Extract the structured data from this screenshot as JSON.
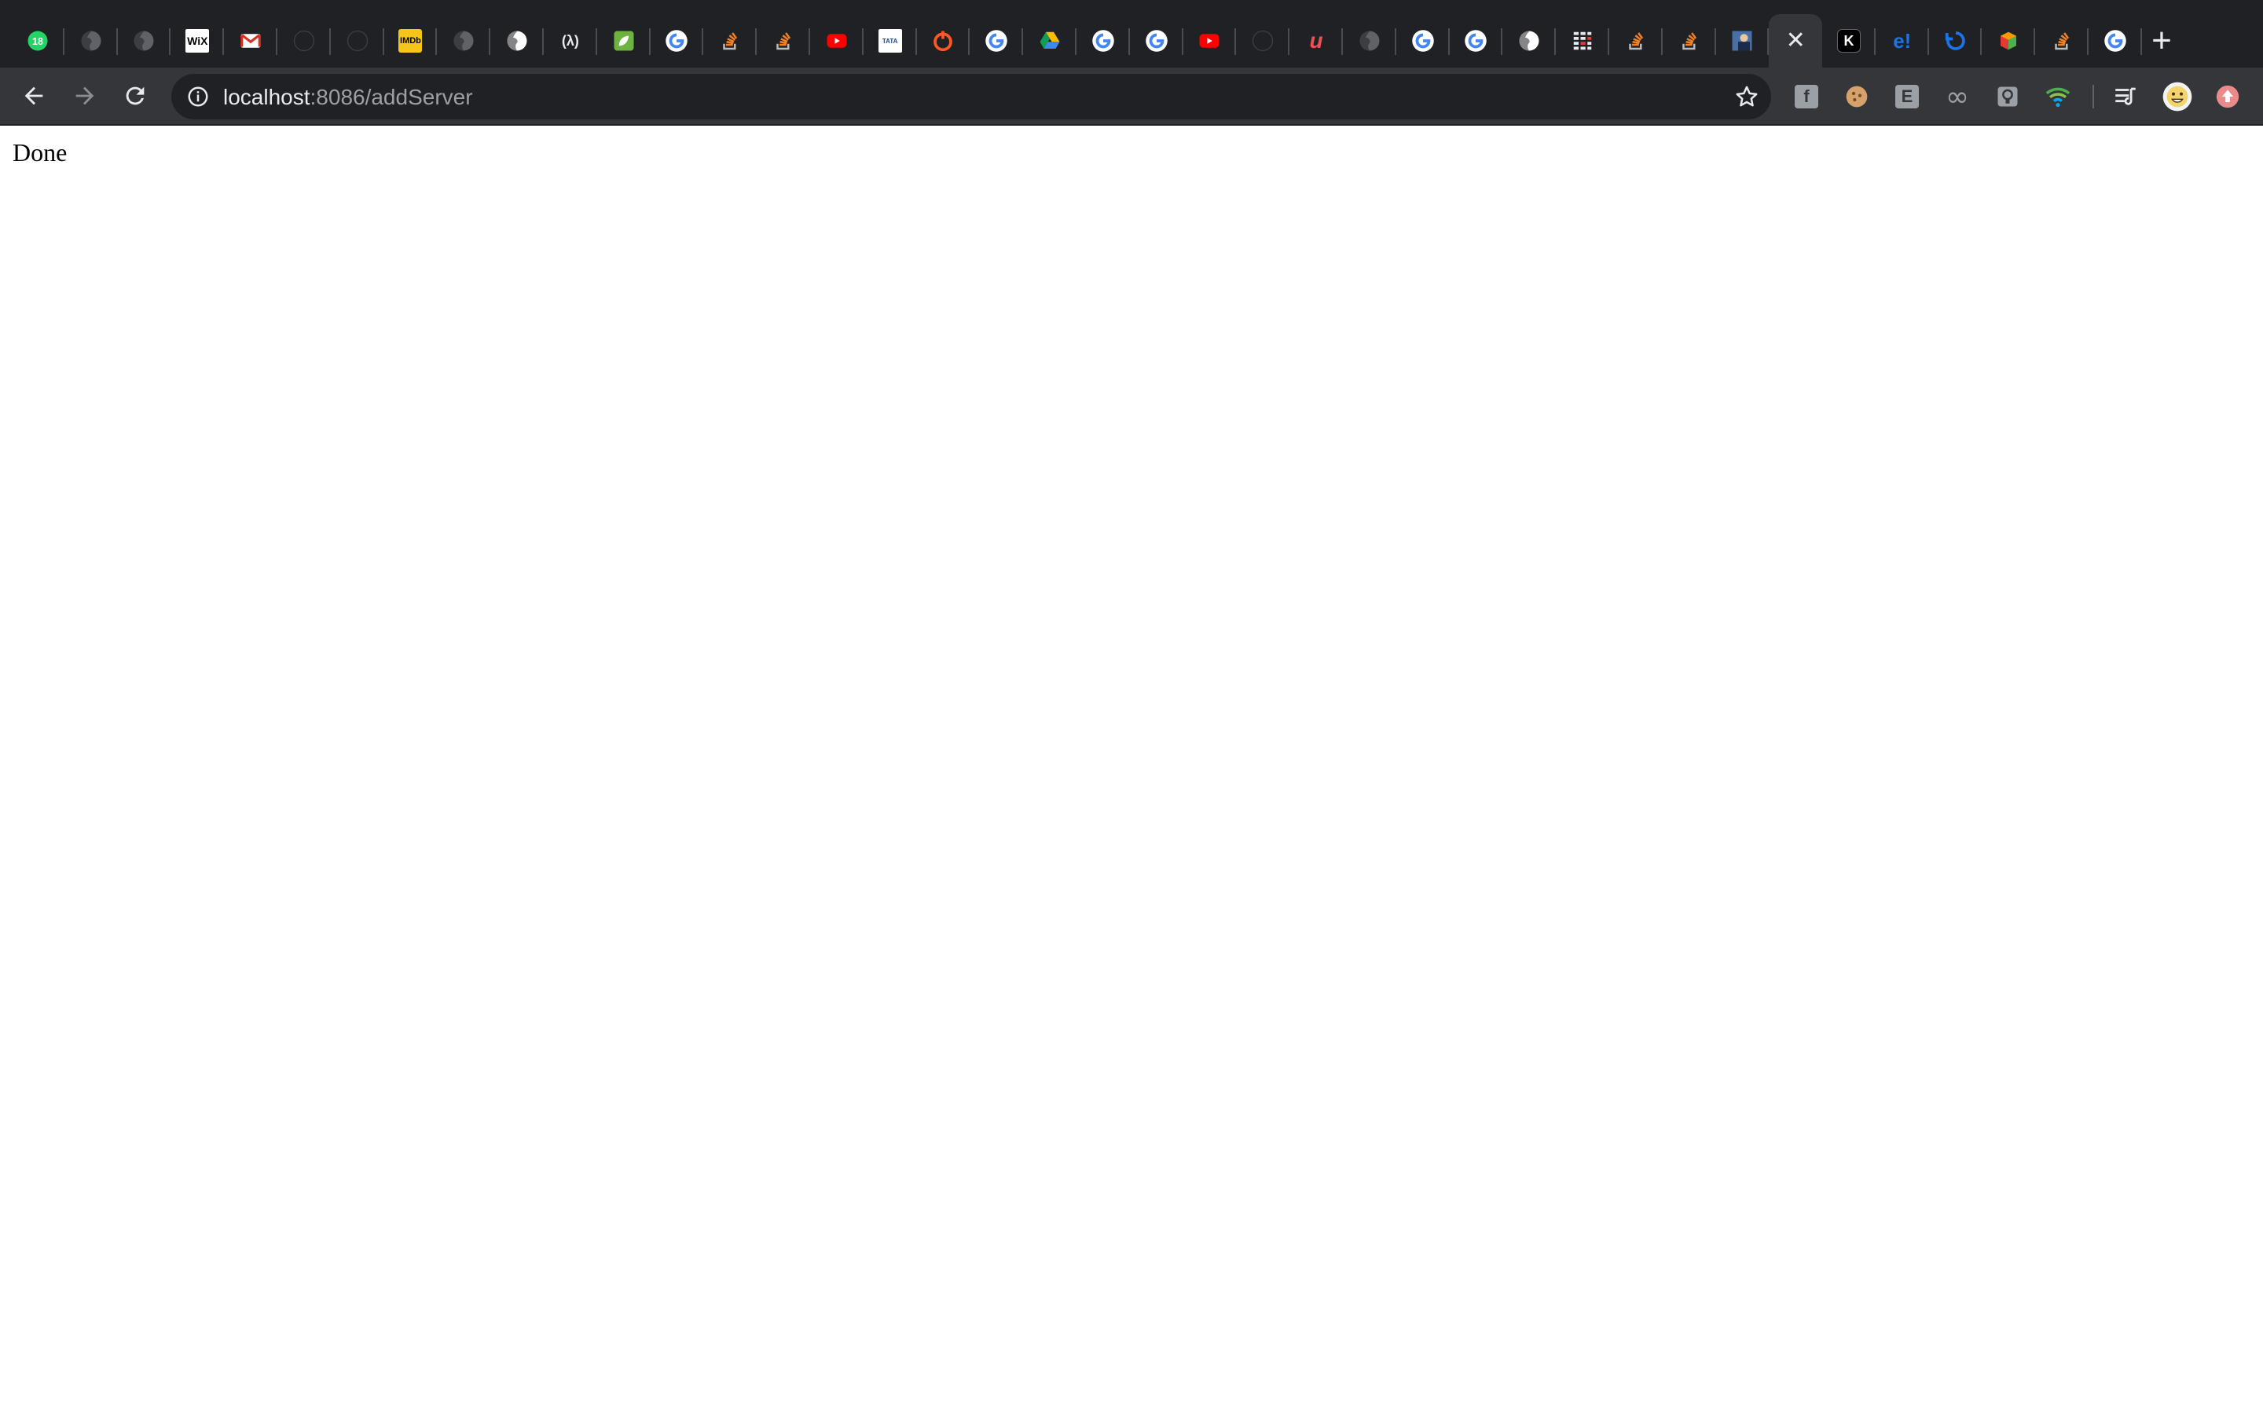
{
  "browser": {
    "tabs": [
      {
        "icon": "whatsapp-icon",
        "text": "18",
        "color": "#25d366"
      },
      {
        "icon": "globe-icon",
        "text": "",
        "color": "#5f6368"
      },
      {
        "icon": "globe-icon",
        "text": "",
        "color": "#5f6368"
      },
      {
        "icon": "wix-icon",
        "text": "WiX",
        "color": "#ffffff"
      },
      {
        "icon": "gmail-icon",
        "text": "M",
        "color": "#ffffff"
      },
      {
        "icon": "github-icon",
        "text": "",
        "color": "#202124"
      },
      {
        "icon": "github-icon",
        "text": "",
        "color": "#202124"
      },
      {
        "icon": "imdb-icon",
        "text": "IMDb",
        "color": "#f5c518"
      },
      {
        "icon": "globe-icon",
        "text": "",
        "color": "#5f6368"
      },
      {
        "icon": "globe-icon",
        "text": "",
        "color": "#ffffff"
      },
      {
        "icon": "freecodecamp-icon",
        "text": "(λ)",
        "color": "#202124"
      },
      {
        "icon": "leaf-icon",
        "text": "",
        "color": "#6db33f"
      },
      {
        "icon": "google-icon",
        "text": "G",
        "color": "#ffffff"
      },
      {
        "icon": "stackoverflow-icon",
        "text": "",
        "color": "#f48024"
      },
      {
        "icon": "stackoverflow-icon",
        "text": "",
        "color": "#f48024"
      },
      {
        "icon": "youtube-icon",
        "text": "",
        "color": "#ff0000"
      },
      {
        "icon": "tata-icon",
        "text": "TATA",
        "color": "#ffffff"
      },
      {
        "icon": "power-icon",
        "text": "",
        "color": "#ff5722"
      },
      {
        "icon": "google-icon",
        "text": "G",
        "color": "#ffffff"
      },
      {
        "icon": "google-drive-icon",
        "text": "",
        "color": "#fbbc04"
      },
      {
        "icon": "google-icon",
        "text": "G",
        "color": "#ffffff"
      },
      {
        "icon": "google-icon",
        "text": "G",
        "color": "#ffffff"
      },
      {
        "icon": "youtube-icon",
        "text": "",
        "color": "#ff0000"
      },
      {
        "icon": "github-icon",
        "text": "",
        "color": "#202124"
      },
      {
        "icon": "udemy-icon",
        "text": "u",
        "color": "#ec5252"
      },
      {
        "icon": "globe-icon",
        "text": "",
        "color": "#5f6368"
      },
      {
        "icon": "google-icon",
        "text": "G",
        "color": "#ffffff"
      },
      {
        "icon": "google-icon",
        "text": "G",
        "color": "#ffffff"
      },
      {
        "icon": "globe-icon",
        "text": "",
        "color": "#ffffff"
      },
      {
        "icon": "grid-icon",
        "text": "",
        "color": "#e8eaed"
      },
      {
        "icon": "stackoverflow-icon",
        "text": "",
        "color": "#f48024"
      },
      {
        "icon": "stackoverflow-icon",
        "text": "",
        "color": "#f48024"
      },
      {
        "icon": "image-icon",
        "text": "",
        "color": "#4a6fa5"
      },
      {
        "icon": "close-icon",
        "text": "✕",
        "color": "#e8eaed",
        "active": true
      },
      {
        "icon": "k-icon",
        "text": "K",
        "color": "#ffffff"
      },
      {
        "icon": "e-icon",
        "text": "e!",
        "color": "#1a73e8"
      },
      {
        "icon": "refresh-logo-icon",
        "text": "",
        "color": "#1a73e8"
      },
      {
        "icon": "cube-icon",
        "text": "",
        "color": "#4caf50"
      },
      {
        "icon": "stackoverflow-icon",
        "text": "",
        "color": "#f48024"
      },
      {
        "icon": "google-icon",
        "text": "G",
        "color": "#ffffff"
      }
    ],
    "new_tab_label": "+",
    "address": {
      "host": "localhost",
      "path": ":8086/addServer"
    },
    "extensions": [
      {
        "icon": "facebook-icon",
        "text": "f",
        "color": "#9aa0a6"
      },
      {
        "icon": "cookie-icon",
        "text": "",
        "color": "#d7a26a"
      },
      {
        "icon": "e-extension-icon",
        "text": "E",
        "color": "#9aa0a6"
      },
      {
        "icon": "infinity-icon",
        "text": "∞",
        "color": "#9aa0a6"
      },
      {
        "icon": "lightbulb-icon",
        "text": "",
        "color": "#9aa0a6"
      },
      {
        "icon": "wifi-icon",
        "text": "",
        "color": "#4caf50"
      },
      {
        "icon": "reading-list-icon",
        "text": "",
        "color": "#e8eaed"
      },
      {
        "icon": "avatar-icon",
        "text": "",
        "color": "#f5d36b"
      },
      {
        "icon": "update-icon",
        "text": "",
        "color": "#ea8a8a"
      }
    ]
  },
  "page": {
    "body_text": "Done"
  }
}
